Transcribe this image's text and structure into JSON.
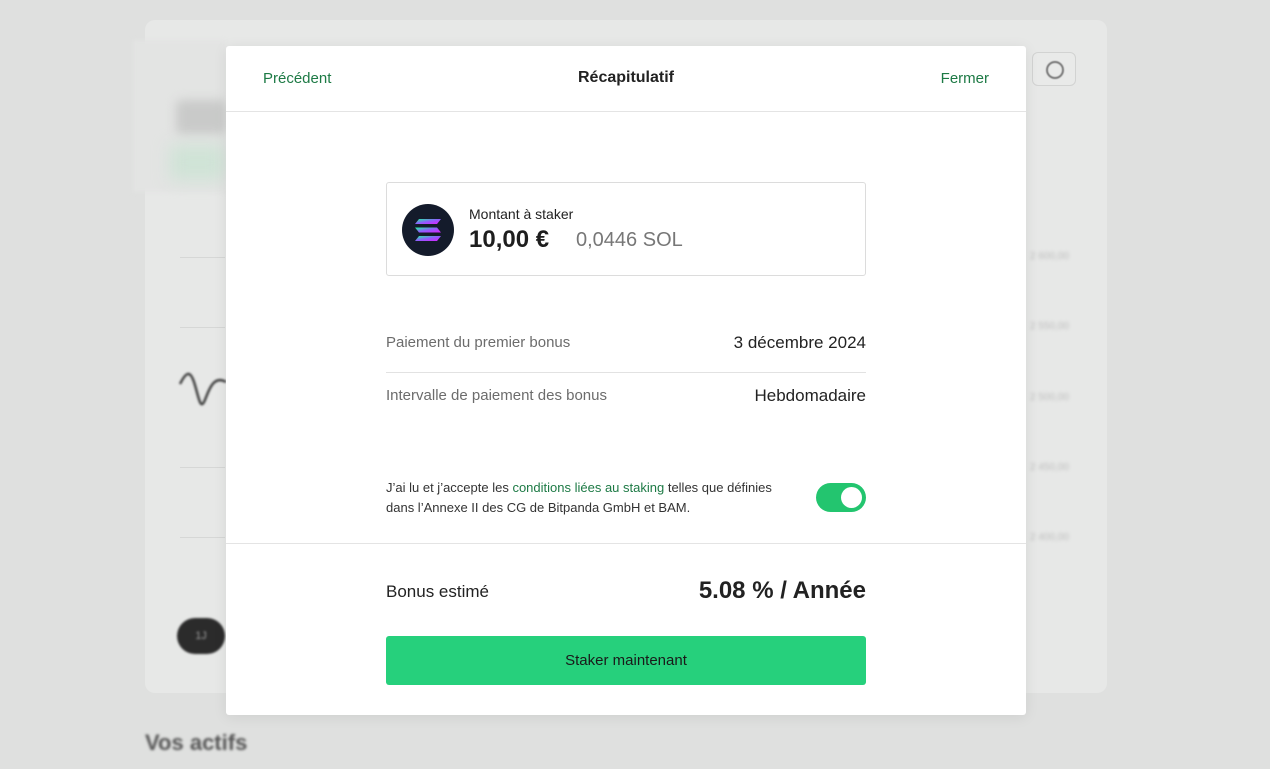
{
  "background": {
    "axis_labels": [
      "2 600,00",
      "2 550,00",
      "2 500,00",
      "2 450,00",
      "2 400,00"
    ],
    "range_pill": "1J",
    "section_heading": "Vos actifs"
  },
  "modal": {
    "prev_label": "Précédent",
    "title": "Récapitulatif",
    "close_label": "Fermer",
    "amount": {
      "label": "Montant à staker",
      "eur": "10,00 €",
      "sol": "0,0446 SOL",
      "asset_icon": "solana-logo-icon"
    },
    "details": [
      {
        "label": "Paiement du premier bonus",
        "value": "3 décembre 2024"
      },
      {
        "label": "Intervalle de paiement des bonus",
        "value": "Hebdomadaire"
      }
    ],
    "terms": {
      "before": "J’ai lu et j’accepte les ",
      "link": "conditions liées au staking",
      "after": " telles que définies dans l’Annexe II des CG de Bitpanda GmbH et BAM.",
      "accepted": true
    },
    "bonus": {
      "label": "Bonus estimé",
      "value": "5.08 % / Année"
    },
    "cta_label": "Staker maintenant"
  },
  "colors": {
    "accent_green": "#26d07c",
    "link_green": "#1d7a45",
    "toggle_on": "#23c56f",
    "backdrop": "#dfe0df"
  }
}
